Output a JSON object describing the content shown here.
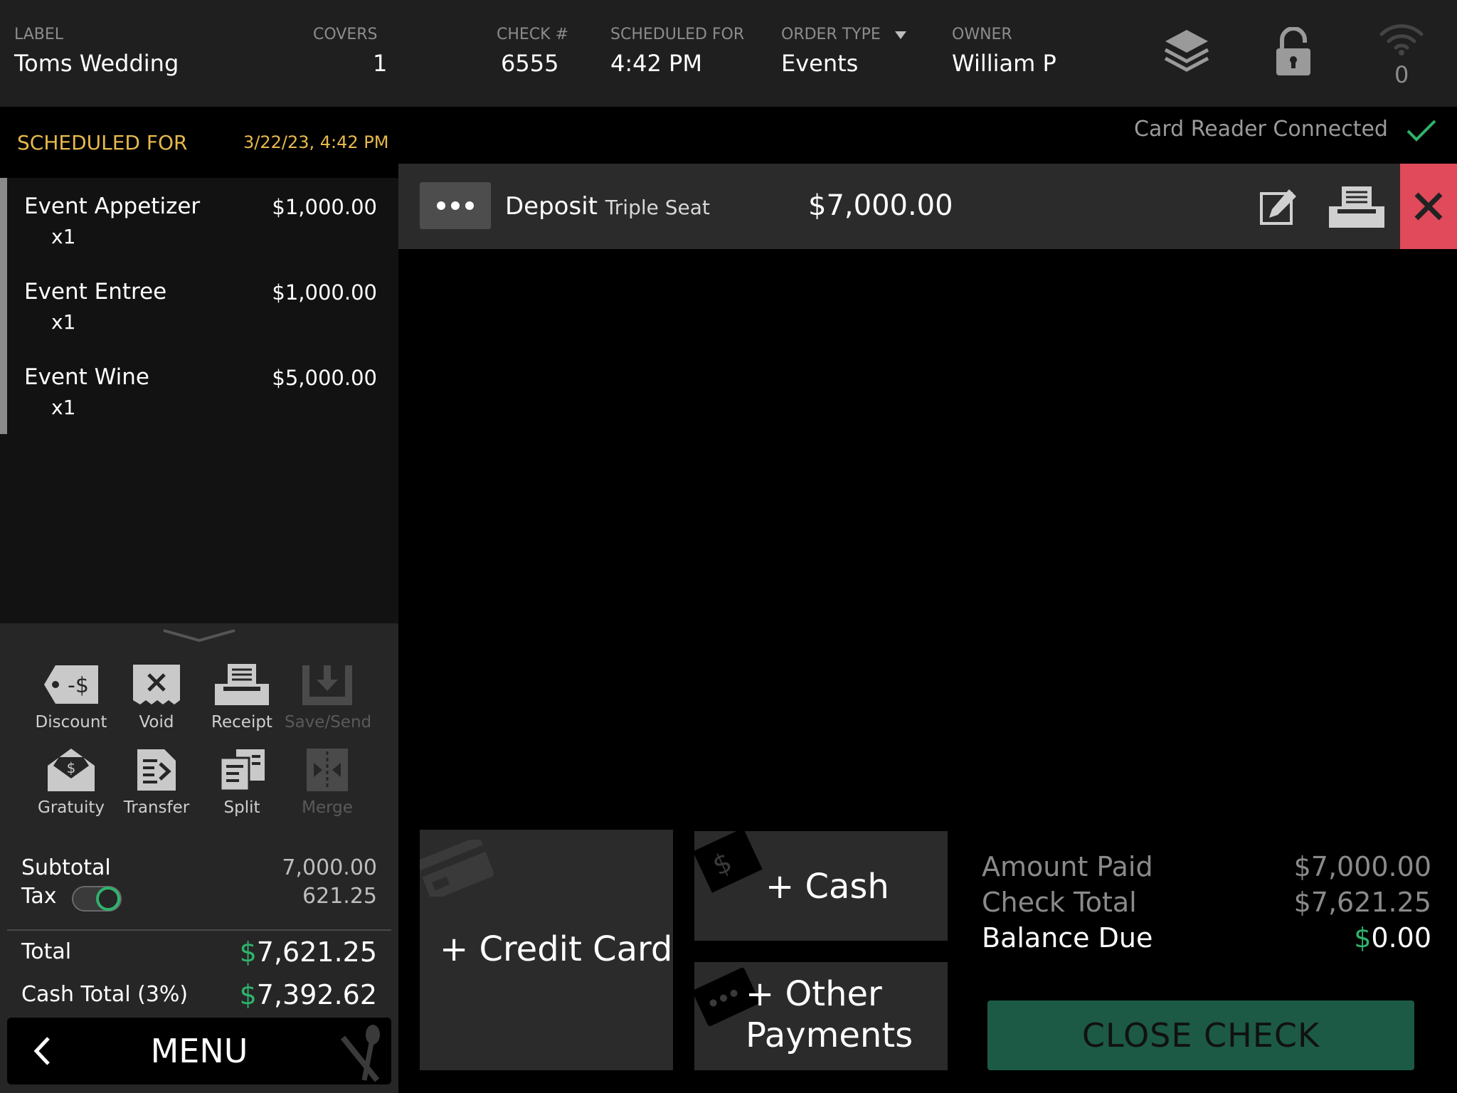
{
  "header": {
    "label_caption": "LABEL",
    "label_value": "Toms Wedding",
    "covers_caption": "COVERS",
    "covers_value": "1",
    "check_caption": "CHECK #",
    "check_value": "6555",
    "scheduled_caption": "SCHEDULED FOR",
    "scheduled_value": "4:42 PM",
    "order_type_caption": "ORDER TYPE",
    "order_type_value": "Events",
    "owner_caption": "OWNER",
    "owner_value": "William P",
    "wifi_count": "0",
    "icons": [
      "layers-icon",
      "lock-icon",
      "wifi-icon"
    ]
  },
  "schedule": {
    "label": "SCHEDULED FOR",
    "datetime": "3/22/23, 4:42 PM"
  },
  "items": [
    {
      "name": "Event Appetizer",
      "price": "$1,000.00",
      "qty": "x1"
    },
    {
      "name": "Event Entree",
      "price": "$1,000.00",
      "qty": "x1"
    },
    {
      "name": "Event Wine",
      "price": "$5,000.00",
      "qty": "x1"
    }
  ],
  "actions": {
    "discount": "Discount",
    "discount_glyph": "-$",
    "void": "Void",
    "receipt": "Receipt",
    "save_send": "Save/Send",
    "gratuity": "Gratuity",
    "transfer": "Transfer",
    "split": "Split",
    "merge": "Merge"
  },
  "summary": {
    "subtotal_label": "Subtotal",
    "subtotal_value": "7,000.00",
    "tax_label": "Tax",
    "tax_value": "621.25",
    "tax_enabled": true,
    "total_label": "Total",
    "total_currency": "$",
    "total_value": "7,621.25",
    "cash_total_label": "Cash Total (3%)",
    "cash_total_currency": "$",
    "cash_total_value": "7,392.62"
  },
  "menu": {
    "label": "MENU"
  },
  "card_reader": {
    "status": "Card Reader Connected"
  },
  "payment": {
    "method": "Deposit",
    "source": "Triple Seat",
    "amount": "$7,000.00"
  },
  "pay_buttons": {
    "credit_card": "+ Credit Card",
    "cash": "+ Cash",
    "other_line1": "+ Other",
    "other_line2": "Payments",
    "cash_icon_glyph": "$"
  },
  "totals": {
    "amount_paid_label": "Amount Paid",
    "amount_paid_value": "$7,000.00",
    "check_total_label": "Check Total",
    "check_total_value": "$7,621.25",
    "balance_due_label": "Balance Due",
    "balance_due_currency": "$",
    "balance_due_value": "0.00"
  },
  "close_check": {
    "label": "CLOSE CHECK"
  },
  "colors": {
    "accent_gold": "#e7b94c",
    "money_green": "#2fb36d",
    "delete_red": "#e04a5a",
    "close_check_green": "#1c5a46"
  }
}
